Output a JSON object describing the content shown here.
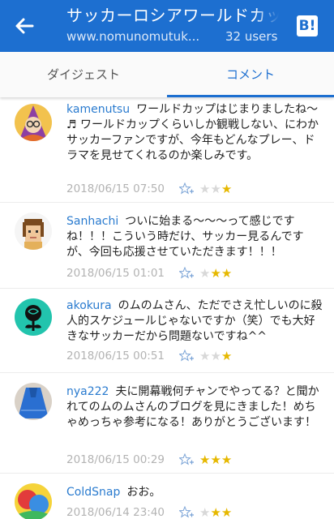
{
  "appbar": {
    "title": "サッカーロシアワールドカップ",
    "subtitle": "www.nomunomutuk...",
    "users": "32 users",
    "b_label": "B!"
  },
  "tabs": [
    {
      "label": "ダイジェスト",
      "active": false
    },
    {
      "label": "コメント",
      "active": true
    }
  ],
  "comments": [
    {
      "user": "kamenutsu",
      "text": "ワールドカップはじまりましたね〜♬ ワールドカップくらいしか観戦しない、にわかサッカーファンですが、今年もどんなプレー、ドラマを見せてくれるのか楽しみです。",
      "time": "2018/06/15 07:50",
      "stars": [
        false,
        false,
        true
      ],
      "avatar": "witch-avatar"
    },
    {
      "user": "Sanhachi",
      "text": "ついに始まる〜〜〜って感じですね！！！こういう時だけ、サッカー見るんですが、今回も応援させていただきます！！！",
      "time": "2018/06/15 01:01",
      "stars": [
        false,
        true,
        true
      ],
      "avatar": "pixel-face-avatar"
    },
    {
      "user": "akokura",
      "text": "のムのムさん、ただでさえ忙しいのに殺人的スケジュールじゃないですか（笑）でも大好きなサッカーだから問題ないですね^^",
      "time": "2018/06/15 00:51",
      "stars": [
        false,
        false,
        true
      ],
      "avatar": "rose-avatar"
    },
    {
      "user": "nya222",
      "text": "夫に開幕戦何チャンでやってる？と聞かれてのムのムさんのブログを見にきました！めちゃめっちゃ参考になる！ありがとうございます！",
      "time": "2018/06/15 00:29",
      "stars": [
        true,
        true,
        true
      ],
      "avatar": "blue-dress-avatar"
    },
    {
      "user": "ColdSnap",
      "text": "おお。",
      "time": "2018/06/14 23:40",
      "stars": [
        false,
        true,
        true
      ],
      "avatar": "colorful-avatar"
    }
  ],
  "colors": {
    "appbar": "#1d6fd0",
    "accent": "#1d6fd0",
    "username": "#2a7bcf",
    "star": "#e6b800"
  }
}
